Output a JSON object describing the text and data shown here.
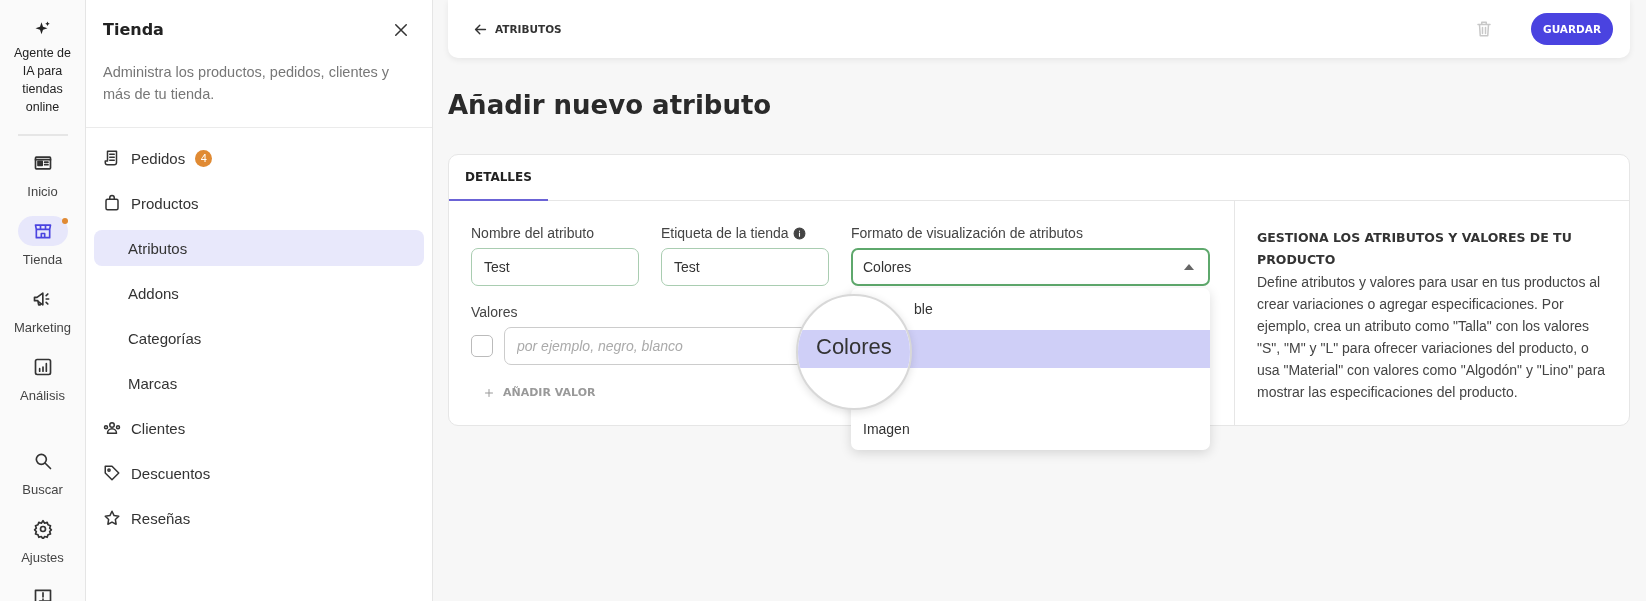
{
  "rail": {
    "agent": {
      "label": "Agente de IA para tiendas online"
    },
    "items": [
      {
        "kind": "home",
        "label": "Inicio",
        "selected": false,
        "notification": false
      },
      {
        "kind": "store",
        "label": "Tienda",
        "selected": true,
        "notification": true
      },
      {
        "kind": "megaphone",
        "label": "Marketing",
        "selected": false,
        "notification": false
      },
      {
        "kind": "chart",
        "label": "Análisis",
        "selected": false,
        "notification": false
      },
      {
        "kind": "search",
        "label": "Buscar",
        "selected": false,
        "notification": false
      },
      {
        "kind": "gear",
        "label": "Ajustes",
        "selected": false,
        "notification": false
      },
      {
        "kind": "feedback",
        "selected": false,
        "notification": false
      }
    ]
  },
  "sidebar": {
    "title": "Tienda",
    "description": "Administra los productos, pedidos, clientes y más de tu tienda.",
    "items": [
      {
        "kind": "receipt",
        "label": "Pedidos",
        "badge": "4",
        "selected": false
      },
      {
        "kind": "bag",
        "label": "Productos",
        "selected": false,
        "children": [
          {
            "label": "Atributos",
            "selected": true
          },
          {
            "label": "Addons",
            "selected": false
          },
          {
            "label": "Categorías",
            "selected": false
          },
          {
            "label": "Marcas",
            "selected": false
          }
        ]
      },
      {
        "kind": "people",
        "label": "Clientes",
        "selected": false
      },
      {
        "kind": "tag",
        "label": "Descuentos",
        "selected": false
      },
      {
        "kind": "star",
        "label": "Reseñas",
        "selected": false
      }
    ]
  },
  "topbar": {
    "back": "ATRIBUTOS",
    "save": "GUARDAR"
  },
  "heading": "Añadir nuevo atributo",
  "tabs": [
    {
      "label": "DETALLES",
      "selected": true
    }
  ],
  "form": {
    "name": {
      "label": "Nombre del atributo",
      "value": "Test"
    },
    "store_label": {
      "label": "Etiqueta de la tienda",
      "value": "Test"
    },
    "format": {
      "label": "Formato de visualización de atributos",
      "value": "Colores",
      "expanded": true,
      "options": [
        {
          "kind": "partial",
          "label": "ble",
          "selected": false
        },
        {
          "kind": "magnified",
          "label": "Colores",
          "selected": true
        },
        {
          "kind": "plain",
          "label": "Imagen",
          "selected": false
        }
      ]
    },
    "values": {
      "label": "Valores",
      "checked": false,
      "placeholder": "por ejemplo, negro, blanco",
      "add": "AÑADIR VALOR"
    }
  },
  "help": {
    "title": "GESTIONA LOS ATRIBUTOS Y VALORES DE TU PRODUCTO",
    "text": "Define atributos y valores para usar en tus productos al crear variaciones o agregar especificaciones. Por ejemplo, crea un atributo como \"Talla\" con los valores \"S\", \"M\" y \"L\" para ofrecer variaciones del producto, o usa \"Material\" con valores como \"Algodón\" y \"Lino\" para mostrar las especificaciones del producto."
  }
}
